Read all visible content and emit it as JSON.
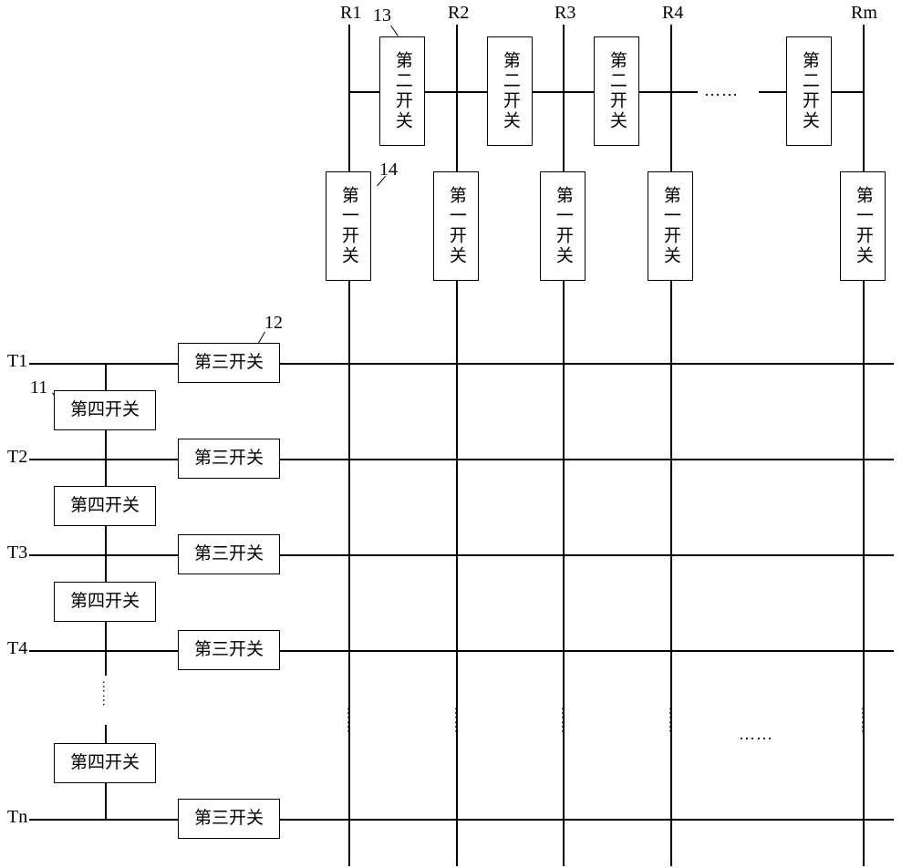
{
  "columns": {
    "R1": "R1",
    "R2": "R2",
    "R3": "R3",
    "R4": "R4",
    "Rm": "Rm"
  },
  "rows": {
    "T1": "T1",
    "T2": "T2",
    "T3": "T3",
    "T4": "T4",
    "Tn": "Tn"
  },
  "switch": {
    "s1": "第一开关",
    "s2": "第二开关",
    "s3": "第三开关",
    "s4": "第四开关"
  },
  "ref": {
    "n11": "11",
    "n12": "12",
    "n13": "13",
    "n14": "14"
  },
  "ellipsis": "……"
}
